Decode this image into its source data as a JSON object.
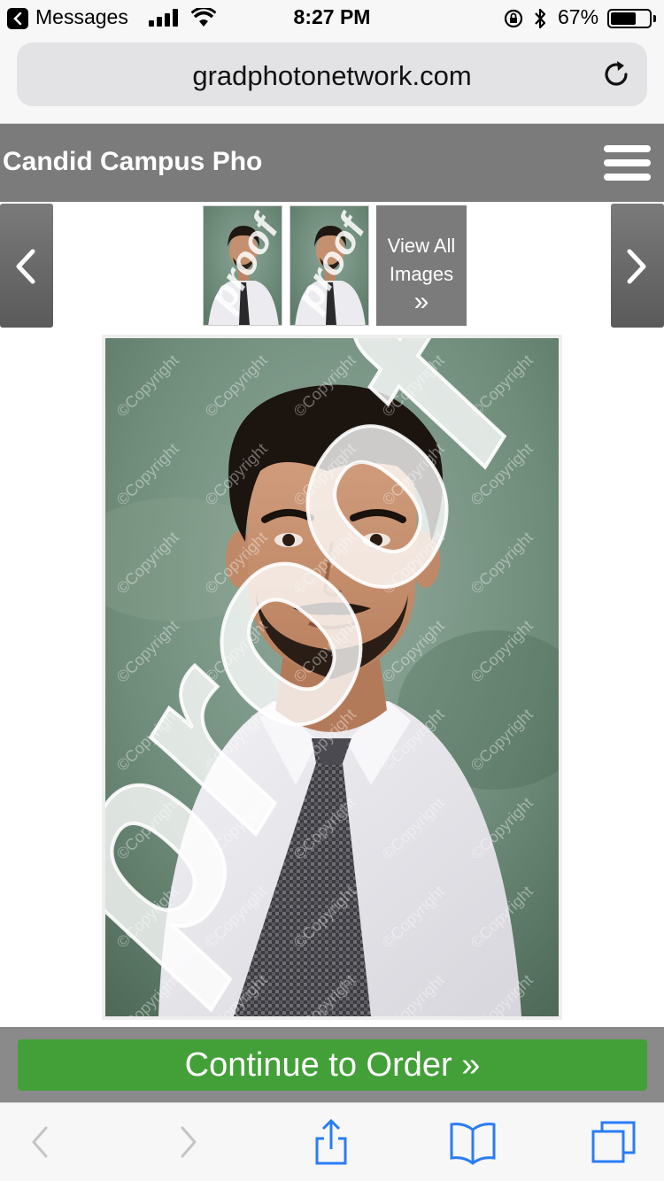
{
  "status_bar": {
    "back_app": "Messages",
    "time": "8:27 PM",
    "battery_percent": "67%",
    "battery_level": 0.67,
    "icons": [
      "back-icon",
      "signal-icon",
      "wifi-icon",
      "rotation-lock-icon",
      "bluetooth-icon",
      "battery-icon"
    ]
  },
  "browser": {
    "url": "gradphotonetwork.com",
    "reload_icon": "reload-icon"
  },
  "site": {
    "title": "Candid Campus Pho",
    "menu_icon": "hamburger-menu-icon"
  },
  "gallery": {
    "prev_icon": "chevron-left-icon",
    "next_icon": "chevron-right-icon",
    "view_all_line1": "View All",
    "view_all_line2": "Images",
    "view_all_icon": "»",
    "watermark_proof": "proof",
    "watermark_copyright": "©Copyright"
  },
  "order": {
    "button_label": "Continue to Order »",
    "button_color": "#43a038"
  },
  "toolbar": {
    "icons": [
      "back-icon",
      "forward-icon",
      "share-icon",
      "bookmarks-icon",
      "tabs-icon"
    ]
  },
  "colors": {
    "header_gray": "#7b7b7b",
    "background_green": "#6d8a78"
  }
}
